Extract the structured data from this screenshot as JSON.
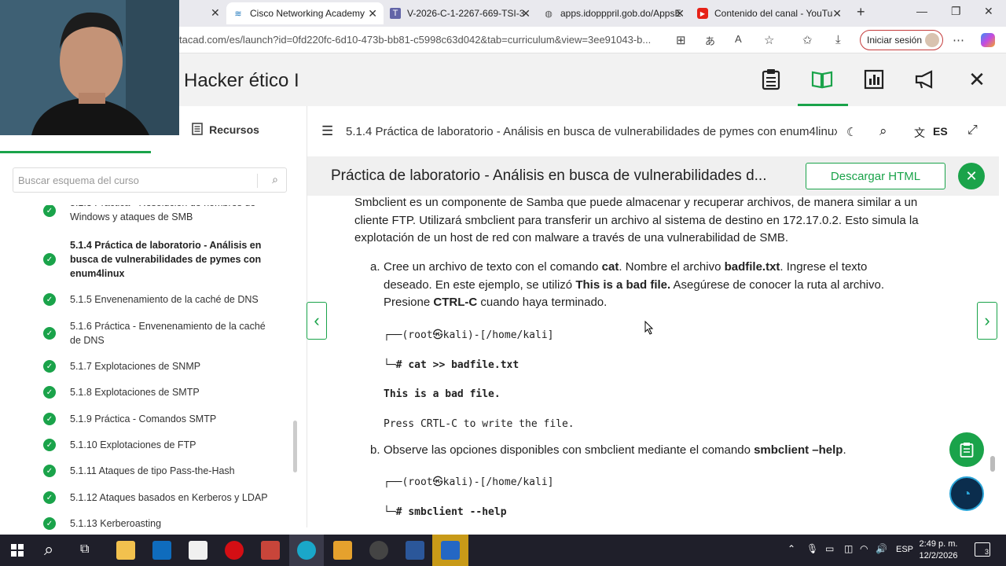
{
  "browser": {
    "tabs": [
      {
        "title": "Cisco Networking Academy",
        "icon": "cisco-icon",
        "active": true
      },
      {
        "title": "V-2026-C-1-2267-669-TSI-3",
        "icon": "teams-icon",
        "active": false
      },
      {
        "title": "apps.idopppril.gob.do/AppsE",
        "icon": "globe-icon",
        "active": false
      },
      {
        "title": "Contenido del canal - YouTu",
        "icon": "youtube-icon",
        "active": false
      }
    ],
    "url": "tacad.com/es/launch?id=0fd220fc-6d10-473b-bb81-c5998c63d042&tab=curriculum&view=3ee91043-b...",
    "signin_label": "Iniciar sesión"
  },
  "course": {
    "title": "Hacker ético I",
    "resources_label": "Recursos",
    "search_placeholder": "Buscar esquema del curso"
  },
  "outline": [
    {
      "label": "5.1.3 Práctica - Resolución de nombres de Windows y ataques de SMB",
      "current": false
    },
    {
      "label": "5.1.4 Práctica de laboratorio - Análisis en busca de vulnerabilidades de pymes con enum4linux",
      "current": true
    },
    {
      "label": "5.1.5 Envenenamiento de la caché de DNS",
      "current": false
    },
    {
      "label": "5.1.6 Práctica - Envenenamiento de la caché de DNS",
      "current": false
    },
    {
      "label": "5.1.7 Explotaciones de SNMP",
      "current": false
    },
    {
      "label": "5.1.8 Explotaciones de SMTP",
      "current": false
    },
    {
      "label": "5.1.9 Práctica - Comandos SMTP",
      "current": false
    },
    {
      "label": "5.1.10 Explotaciones de FTP",
      "current": false
    },
    {
      "label": "5.1.11 Ataques de tipo Pass-the-Hash",
      "current": false
    },
    {
      "label": "5.1.12 Ataques basados en Kerberos y LDAP",
      "current": false
    },
    {
      "label": "5.1.13 Kerberoasting",
      "current": false
    }
  ],
  "content": {
    "breadcrumb": "5.1.4 Práctica de laboratorio - Análisis en busca de vulnerabilidades de pymes con enum4linux",
    "lang": "ES",
    "lab_title": "Práctica de laboratorio - Análisis en busca de vulnerabilidades d...",
    "download_label": "Descargar HTML",
    "intro": "Smbclient es un componente de Samba que puede almacenar y recuperar archivos, de manera similar a un cliente FTP. Utilizará smbclient para transferir un archivo al sistema de destino en 172.17.0.2. Esto simula la explotación de un host de red con malware a través de una vulnerabilidad de SMB.",
    "step_a": {
      "letter": "a.",
      "t1": "Cree un archivo de texto con el comando ",
      "b1": "cat",
      "t2": ". Nombre el archivo ",
      "b2": "badfile.txt",
      "t3": ". Ingrese el texto deseado. En este ejemplo, se utilizó ",
      "b3": "This is a bad file.",
      "t4": " Asegúrese de conocer la ruta al archivo. Presione ",
      "b4": "CTRL-C",
      "t5": " cuando haya terminado."
    },
    "code_a": {
      "prompt": "┌──(root㉿kali)-[/home/kali]",
      "cmd_prefix": "└─# ",
      "cmd": "cat >> badfile.txt",
      "line1": "This is a bad file.",
      "line2": "Press CRTL-C to write the file."
    },
    "step_b": {
      "letter": "b.",
      "t1": "Observe las opciones disponibles con smbclient mediante el comando ",
      "b1": "smbclient –help",
      "t2": "."
    },
    "code_b": {
      "prompt": "┌──(root㉿kali)-[/home/kali]",
      "cmd_prefix": "└─# ",
      "cmd": "smbclient --help"
    }
  },
  "taskbar": {
    "lang": "ESP",
    "time": "2:49 p. m.",
    "date": "12/2/2026",
    "notifications": "3"
  },
  "colors": {
    "accent_green": "#1aa34a",
    "taskbar": "#1f1f2a"
  }
}
